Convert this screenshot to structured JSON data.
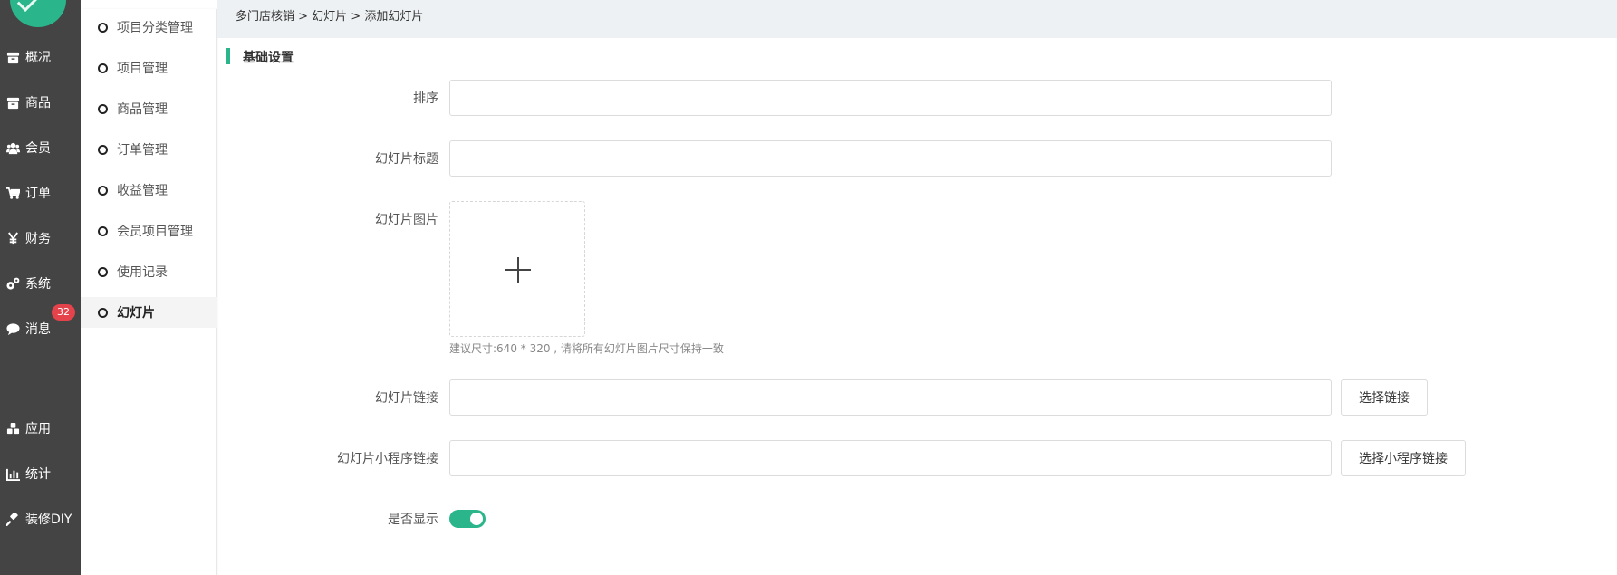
{
  "main_nav": {
    "items": [
      {
        "label": "概况",
        "icon": "archive-icon"
      },
      {
        "label": "商品",
        "icon": "archive-icon"
      },
      {
        "label": "会员",
        "icon": "users-icon"
      },
      {
        "label": "订单",
        "icon": "cart-icon"
      },
      {
        "label": "财务",
        "icon": "yen-icon"
      },
      {
        "label": "系统",
        "icon": "gears-icon"
      },
      {
        "label": "消息",
        "icon": "comment-icon"
      },
      {
        "label": "应用",
        "icon": "cubes-icon"
      },
      {
        "label": "统计",
        "icon": "bar-chart-icon"
      },
      {
        "label": "装修DIY",
        "icon": "gavel-icon"
      }
    ],
    "message_badge": "32"
  },
  "sub_nav": {
    "items": [
      {
        "label": "项目分类管理"
      },
      {
        "label": "项目管理"
      },
      {
        "label": "商品管理"
      },
      {
        "label": "订单管理"
      },
      {
        "label": "收益管理"
      },
      {
        "label": "会员项目管理"
      },
      {
        "label": "使用记录"
      },
      {
        "label": "幻灯片",
        "active": true
      }
    ]
  },
  "breadcrumb": "多门店核销 > 幻灯片 > 添加幻灯片",
  "section": {
    "title": "基础设置"
  },
  "form": {
    "sort_label": "排序",
    "sort_value": "",
    "title_label": "幻灯片标题",
    "title_value": "",
    "image_label": "幻灯片图片",
    "image_hint": "建议尺寸:640 * 320 , 请将所有幻灯片图片尺寸保持一致",
    "link_label": "幻灯片链接",
    "link_value": "",
    "link_button": "选择链接",
    "mini_link_label": "幻灯片小程序链接",
    "mini_link_value": "",
    "mini_link_button": "选择小程序链接",
    "show_label": "是否显示",
    "show_value": true
  },
  "colors": {
    "accent": "#2bb58a",
    "nav_bg": "#444444",
    "badge": "#e5434b"
  }
}
